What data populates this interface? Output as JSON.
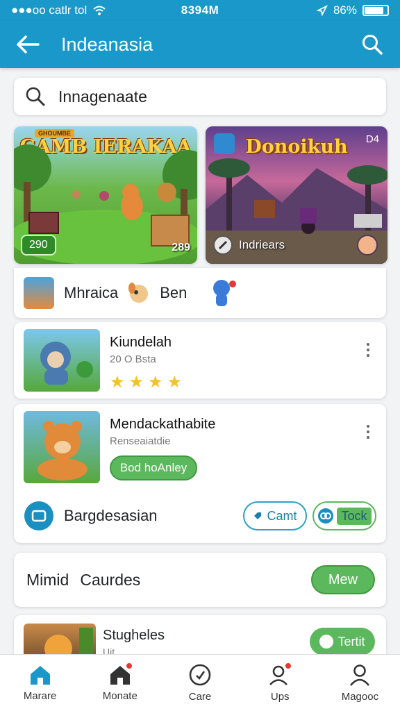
{
  "status_bar": {
    "carrier": "●●●oo catlr tol",
    "time": "8394M",
    "battery": "86%"
  },
  "header": {
    "title": "Indeanasia"
  },
  "search": {
    "value": "Innagenaate"
  },
  "banners": [
    {
      "title": "GAMB IERAKAA",
      "tag": "GHOUMBE",
      "left_badge": "290",
      "right_label": "289"
    },
    {
      "title": "Donoikuh",
      "corner": "D4",
      "caption": "Indriears"
    }
  ],
  "category_row": {
    "label1": "Mhraica",
    "label2": "Ben"
  },
  "games": [
    {
      "title": "Kiundelah",
      "subtitle": "20 O Bsta",
      "stars": [
        "★",
        "★",
        "★",
        "★"
      ]
    },
    {
      "title": "Mendackathabite",
      "subtitle": "Renseaiatdie",
      "button": "Bod hoAnley"
    }
  ],
  "feature_row": {
    "label": "Bargdesasian",
    "btn1": "Camt",
    "btn2": "Tock"
  },
  "section": {
    "title_part1": "Mimid",
    "title_part2": "Caurdes",
    "button": "Mew"
  },
  "partial_item": {
    "title": "Stugheles",
    "subtitle": "Uit",
    "button": "Tertit"
  },
  "nav": [
    {
      "label": "Marare",
      "icon": "home-icon"
    },
    {
      "label": "Monate",
      "icon": "house-badge-icon"
    },
    {
      "label": "Care",
      "icon": "compass-icon"
    },
    {
      "label": "Ups",
      "icon": "user-badge-icon"
    },
    {
      "label": "Magooc",
      "icon": "person-icon"
    }
  ],
  "colors": {
    "primary": "#1a98c9",
    "accent_green": "#5cb85c",
    "badge_red": "#e53935"
  }
}
